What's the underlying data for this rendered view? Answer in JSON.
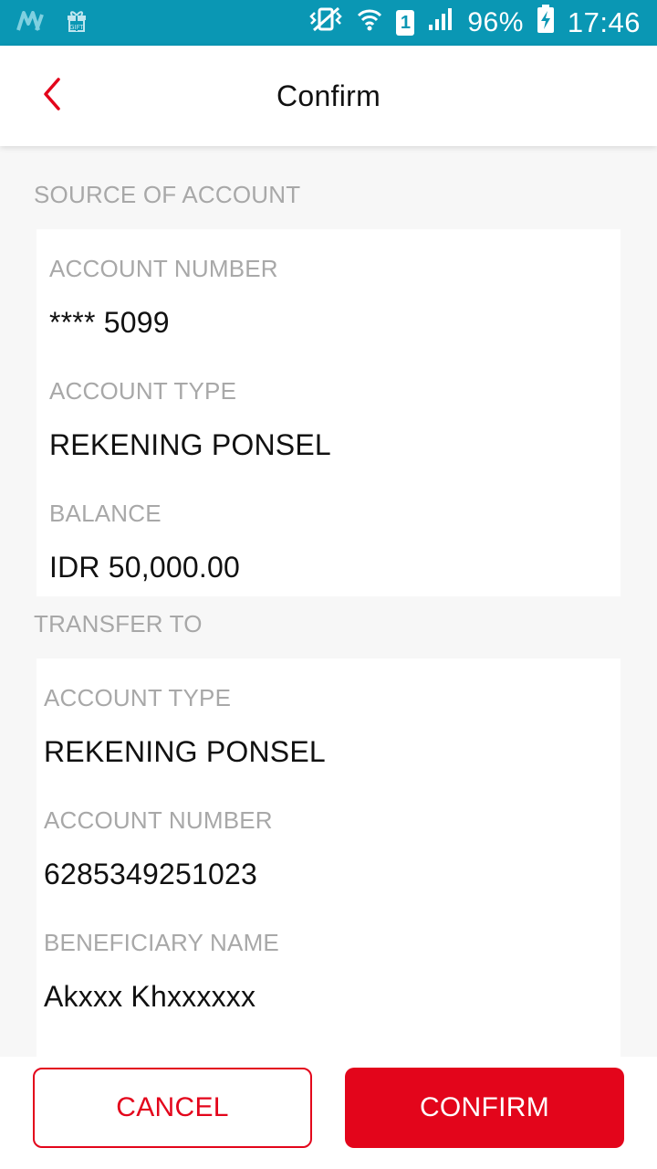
{
  "status_bar": {
    "battery": "96%",
    "time": "17:46",
    "sim": "1",
    "gift_label": "GIFT",
    "icons": [
      "app-m-icon",
      "gift-icon",
      "vibrate-icon",
      "wifi-icon",
      "sim-icon",
      "signal-icon",
      "battery-charging-icon"
    ]
  },
  "header": {
    "title": "Confirm",
    "back_icon": "chevron-left-icon"
  },
  "source": {
    "section_label": "SOURCE OF ACCOUNT",
    "account_number_label": "ACCOUNT NUMBER",
    "account_number": "**** 5099",
    "account_type_label": "ACCOUNT TYPE",
    "account_type": "REKENING PONSEL",
    "balance_label": "BALANCE",
    "balance": "IDR 50,000.00"
  },
  "transfer_to": {
    "section_label": "TRANSFER TO",
    "account_type_label": "ACCOUNT TYPE",
    "account_type": "REKENING PONSEL",
    "account_number_label": "ACCOUNT NUMBER",
    "account_number": "6285349251023",
    "beneficiary_label": "BENEFICIARY NAME",
    "beneficiary": "Akxxx Khxxxxxx"
  },
  "actions": {
    "cancel_label": "CANCEL",
    "confirm_label": "CONFIRM"
  },
  "colors": {
    "status_bar": "#0a97b4",
    "accent": "#e3051b",
    "label": "#a8a8a8",
    "background": "#f7f7f7"
  }
}
